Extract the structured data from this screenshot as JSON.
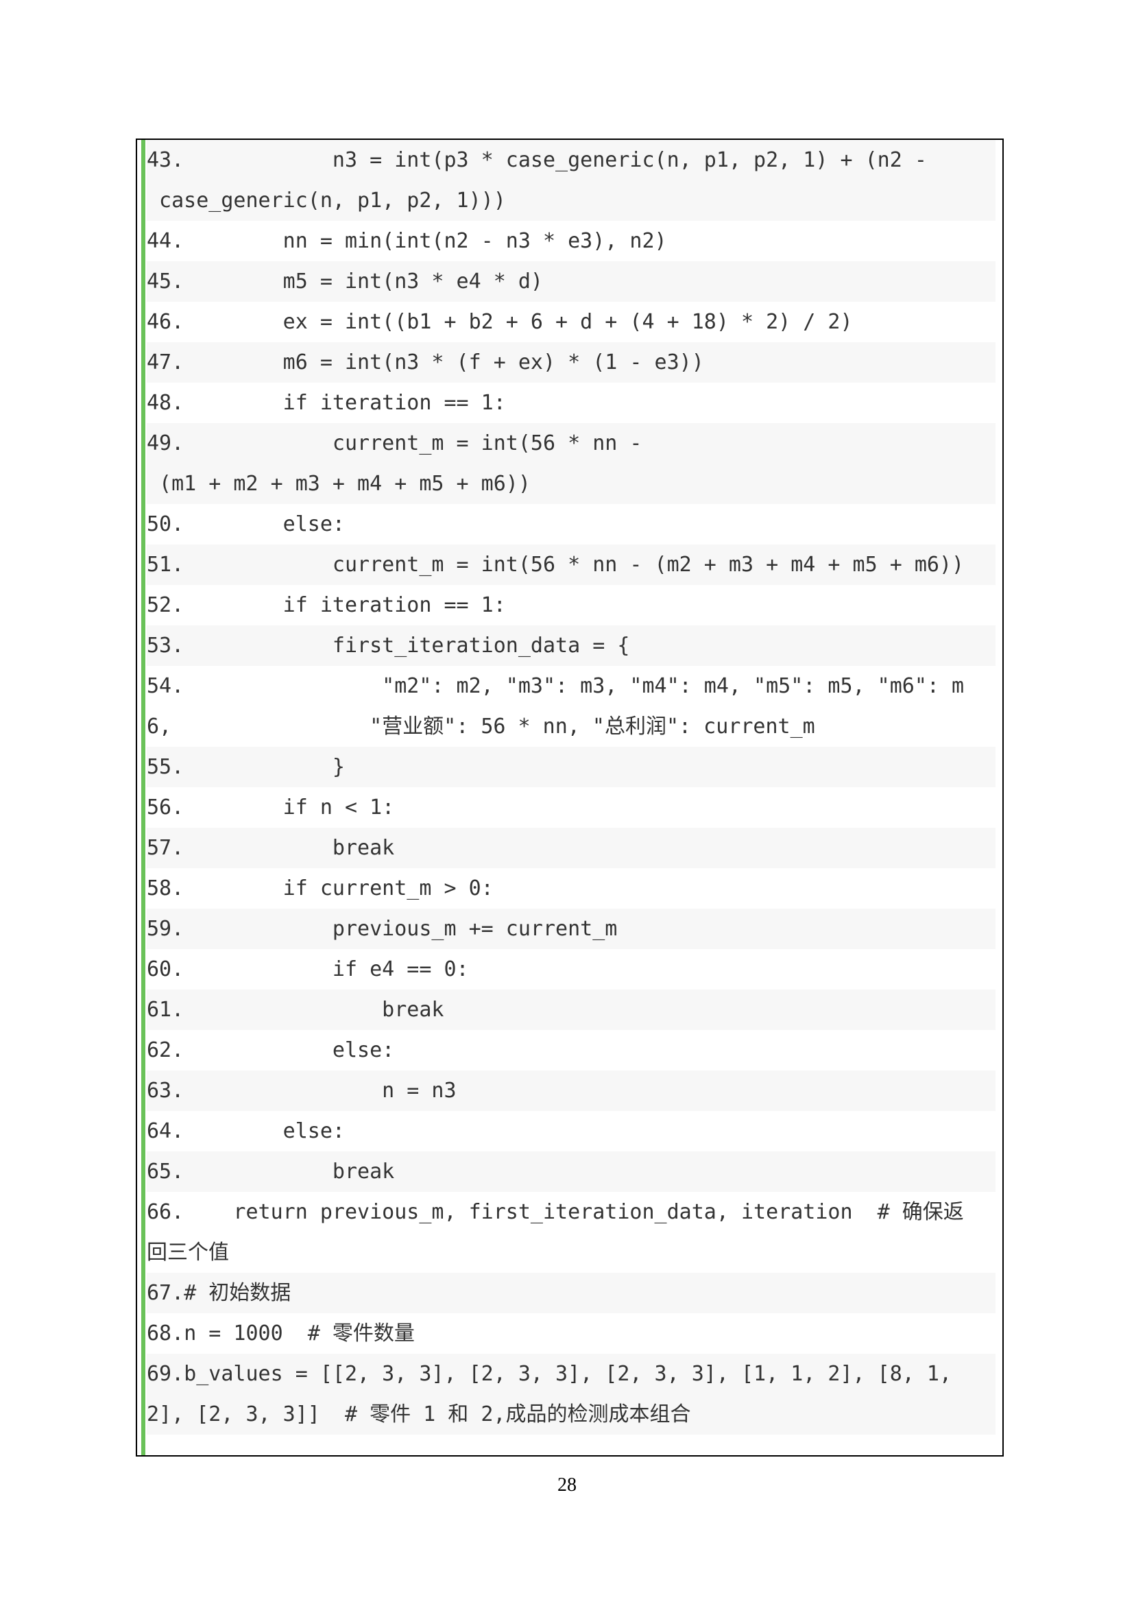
{
  "lines": [
    {
      "n": "43.",
      "a": "            n3 = int(p3 * case_generic(n, p1, p2, 1) + (n2 -",
      "b": " case_generic(n, p1, p2, 1)))"
    },
    {
      "n": "44.",
      "a": "        nn = min(int(n2 - n3 * e3), n2)"
    },
    {
      "n": "45.",
      "a": "        m5 = int(n3 * e4 * d)"
    },
    {
      "n": "46.",
      "a": "        ex = int((b1 + b2 + 6 + d + (4 + 18) * 2) / 2)"
    },
    {
      "n": "47.",
      "a": "        m6 = int(n3 * (f + ex) * (1 - e3))"
    },
    {
      "n": "48.",
      "a": "        if iteration == 1:"
    },
    {
      "n": "49.",
      "a": "            current_m = int(56 * nn -",
      "b": " (m1 + m2 + m3 + m4 + m5 + m6))"
    },
    {
      "n": "50.",
      "a": "        else:"
    },
    {
      "n": "51.",
      "a": "            current_m = int(56 * nn - (m2 + m3 + m4 + m5 + m6))"
    },
    {
      "n": "52.",
      "a": "        if iteration == 1:"
    },
    {
      "n": "53.",
      "a": "            first_iteration_data = {"
    },
    {
      "n": "54.",
      "a": "                \"m2\": m2, \"m3\": m3, \"m4\": m4, \"m5\": m5, \"m6\": m",
      "b": "6,                \"营业额\": 56 * nn, \"总利润\": current_m"
    },
    {
      "n": "55.",
      "a": "            }"
    },
    {
      "n": "56.",
      "a": "        if n < 1:"
    },
    {
      "n": "57.",
      "a": "            break"
    },
    {
      "n": "58.",
      "a": "        if current_m > 0:"
    },
    {
      "n": "59.",
      "a": "            previous_m += current_m"
    },
    {
      "n": "60.",
      "a": "            if e4 == 0:"
    },
    {
      "n": "61.",
      "a": "                break"
    },
    {
      "n": "62.",
      "a": "            else:"
    },
    {
      "n": "63.",
      "a": "                n = n3"
    },
    {
      "n": "64.",
      "a": "        else:"
    },
    {
      "n": "65.",
      "a": "            break"
    },
    {
      "n": "66.",
      "a": "    return previous_m, first_iteration_data, iteration  # 确保返",
      "b": "回三个值"
    },
    {
      "n": "67.",
      "a": "# 初始数据"
    },
    {
      "n": "68.",
      "a": "n = 1000  # 零件数量"
    },
    {
      "n": "69.",
      "a": "b_values = [[2, 3, 3], [2, 3, 3], [2, 3, 3], [1, 1, 2], [8, 1,",
      "b": "2], [2, 3, 3]]  # 零件 1 和 2,成品的检测成本组合"
    }
  ],
  "page_number": "28"
}
